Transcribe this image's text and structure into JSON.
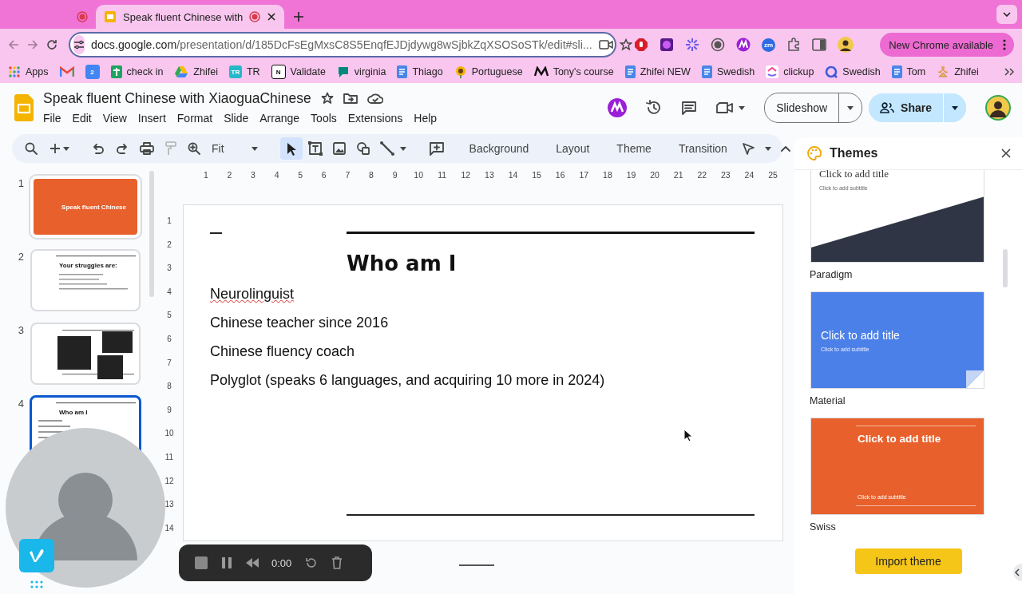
{
  "browser": {
    "tabs": [
      {
        "selected": false
      },
      {
        "title": "Speak fluent Chinese with",
        "selected": true
      }
    ],
    "url_host": "docs.google.com",
    "url_path": "/presentation/d/185DcFsEgMxsC8S5EnqfEJDjdywg8wSjbkZqXSOSoSTk/edit#sli...",
    "extension_badge": "zm",
    "update_button": "New Chrome available",
    "bookmarks": [
      {
        "kind": "apps",
        "label": "Apps"
      },
      {
        "kind": "gmail"
      },
      {
        "kind": "calendar",
        "icon_text": "2"
      },
      {
        "kind": "sheets",
        "label": "check in"
      },
      {
        "kind": "drive",
        "label": "Zhifei"
      },
      {
        "kind": "tile",
        "icon_text": "TR",
        "label": "TR"
      },
      {
        "kind": "notion",
        "icon_text": "N",
        "label": "Validate"
      },
      {
        "kind": "chat",
        "label": "virginia"
      },
      {
        "kind": "docs",
        "label": "Thiago"
      },
      {
        "kind": "flower",
        "label": "Portuguese"
      },
      {
        "kind": "medium",
        "label": "Tony's course"
      },
      {
        "kind": "docs",
        "label": "Zhifei NEW"
      },
      {
        "kind": "docs",
        "label": "Swedish"
      },
      {
        "kind": "clickup",
        "label": "clickup"
      },
      {
        "kind": "ring",
        "label": "Swedish"
      },
      {
        "kind": "docs",
        "label": "Tom"
      },
      {
        "kind": "figure",
        "label": "Zhifei"
      }
    ]
  },
  "document": {
    "title": "Speak fluent Chinese with XiaoguaChinese",
    "menus": [
      "File",
      "Edit",
      "View",
      "Insert",
      "Format",
      "Slide",
      "Arrange",
      "Tools",
      "Extensions",
      "Help"
    ],
    "slideshow_button": "Slideshow",
    "share_button": "Share"
  },
  "toolbar": {
    "zoom": "Fit",
    "tools": [
      {
        "kind": "select",
        "selected": true
      },
      {
        "kind": "textbox",
        "selected": false
      },
      {
        "kind": "image",
        "selected": false
      },
      {
        "kind": "shape",
        "selected": false
      },
      {
        "kind": "line",
        "selected": false
      }
    ],
    "buttons": [
      "Background",
      "Layout",
      "Theme",
      "Transition"
    ]
  },
  "filmstrip": [
    {
      "number": "1",
      "kind": "title",
      "title": "Speak fluent Chinese",
      "selected": false
    },
    {
      "number": "2",
      "kind": "list",
      "title": "Your struggles are:",
      "selected": false
    },
    {
      "number": "3",
      "kind": "screenshots",
      "selected": false
    },
    {
      "number": "4",
      "kind": "list",
      "title": "Who am I",
      "selected": true
    }
  ],
  "rulers": {
    "horizontal": [
      "1",
      "2",
      "3",
      "4",
      "5",
      "6",
      "7",
      "8",
      "9",
      "10",
      "11",
      "12",
      "13",
      "14",
      "15",
      "16",
      "17",
      "18",
      "19",
      "20",
      "21",
      "22",
      "23",
      "24",
      "25"
    ],
    "vertical": [
      "1",
      "2",
      "3",
      "4",
      "5",
      "6",
      "7",
      "8",
      "9",
      "10",
      "11",
      "12",
      "13",
      "14"
    ]
  },
  "slide": {
    "title": "Who am I",
    "lines": [
      "Neurolinguist",
      "Chinese teacher since 2016",
      "Chinese fluency coach",
      "Polyglot (speaks 6 languages, and acquiring 10 more in 2024)"
    ]
  },
  "themes_panel": {
    "title": "Themes",
    "themes": [
      {
        "kind": "paradigm",
        "name": "Paradigm",
        "title": "Click to add title",
        "subtitle": "Click to add subtitle"
      },
      {
        "kind": "material",
        "name": "Material",
        "title": "Click to add title",
        "subtitle": "Click to add subtitle"
      },
      {
        "kind": "swiss",
        "name": "Swiss",
        "title": "Click to add title",
        "subtitle": "Click to add subtitle"
      }
    ],
    "import_button": "Import theme"
  },
  "recorder": {
    "time": "0:00"
  }
}
